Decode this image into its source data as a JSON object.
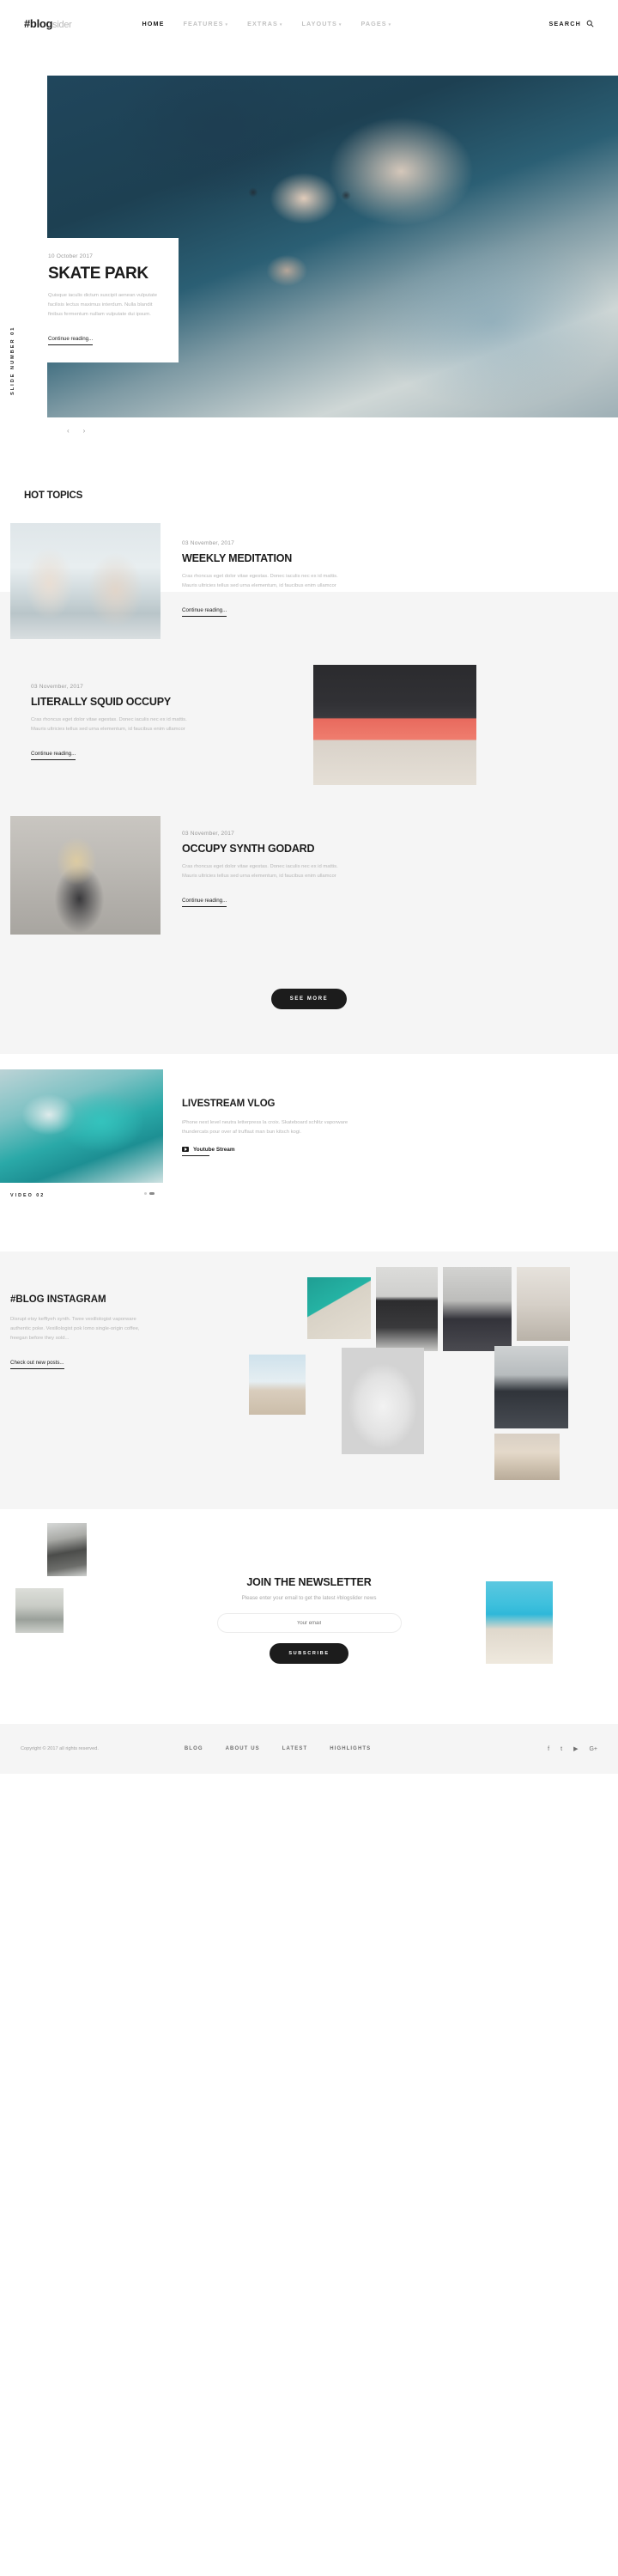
{
  "header": {
    "logo_bold": "#blog",
    "logo_light": "sider",
    "nav": [
      {
        "label": "HOME",
        "caret": ""
      },
      {
        "label": "FEATURES",
        "caret": "▾"
      },
      {
        "label": "EXTRAS",
        "caret": "▾"
      },
      {
        "label": "LAYOUTS",
        "caret": "▾"
      },
      {
        "label": "PAGES",
        "caret": "▾"
      }
    ],
    "search_label": "SEARCH",
    "search_icon": "search-icon"
  },
  "hero": {
    "date": "10 October 2017",
    "title": "SKATE PARK",
    "excerpt": "Quisque iaculis dictum suscipit aenean vulputate facilisis lectus maximus interdum. Nulla blandit finibus fermentum nullam vulputate dui ipsum.",
    "more": "Continue reading...",
    "slide_label": "SLIDE NUMBER 01",
    "prev_icon": "‹",
    "next_icon": "›"
  },
  "hot_topics": {
    "title": "HOT TOPICS",
    "posts": [
      {
        "date": "03 November, 2017",
        "title": "WEEKLY MEDITATION",
        "excerpt": "Cras rhoncus eget dolor vitae egestas. Donec iaculis nec ex id mattis. Mauris ultricies tellus sed urna elementum, id faucibus enim ullamcor",
        "more": "Continue reading..."
      },
      {
        "date": "03 November, 2017",
        "title": "LITERALLY SQUID OCCUPY",
        "excerpt": "Cras rhoncus eget dolor vitae egestas. Donec iaculis nec ex id mattis. Mauris ultricies tellus sed urna elementum, id faucibus enim ullamcor",
        "more": "Continue reading..."
      },
      {
        "date": "03 November, 2017",
        "title": "OCCUPY SYNTH GODARD",
        "excerpt": "Cras rhoncus eget dolor vitae egestas. Donec iaculis nec ex id mattis. Mauris ultricies tellus sed urna elementum, id faucibus enim ullamcor",
        "more": "Continue reading..."
      }
    ],
    "see_more": "SEE MORE"
  },
  "vlog": {
    "title": "LIVESTREAM VLOG",
    "excerpt": "iPhone next level neutra letterpress la croix. Skateboard schlitz vaporware thundercats pour over af truffaut man bun kitsch kogi.",
    "link": "Youtube Stream",
    "caption": "VIDEO 02"
  },
  "instagram": {
    "title": "#BLOG INSTAGRAM",
    "excerpt": "Disrupt etsy keffiyeh synth. Twee vexillologist vaporware authentic poke. Vexillologist pok lomo single-origin coffee, freegan before they sold...",
    "link": "Check out new posts..."
  },
  "newsletter": {
    "title": "JOIN THE NEWSLETTER",
    "subtitle": "Please enter your email to get the latest #blogslider news",
    "email_placeholder": "Your email",
    "email_value": "",
    "button": "SUBSCRIBE"
  },
  "footer": {
    "copyright": "Copyright © 2017 all rights reserved.",
    "links": [
      "BLOG",
      "ABOUT US",
      "LATEST",
      "HIGHLIGHTS"
    ],
    "socials": [
      {
        "name": "facebook-icon",
        "glyph": "f"
      },
      {
        "name": "twitter-icon",
        "glyph": "t"
      },
      {
        "name": "youtube-icon",
        "glyph": "▶"
      },
      {
        "name": "google-plus-icon",
        "glyph": "G+"
      }
    ]
  },
  "colors": {
    "accent": "#1c1c1c",
    "muted": "#b6b6b6",
    "band": "#f5f5f5"
  }
}
